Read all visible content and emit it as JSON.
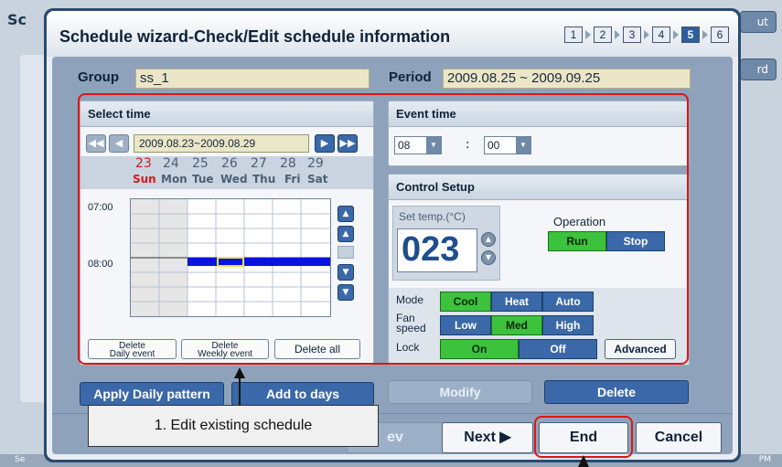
{
  "background": {
    "title_fragment": "Sc",
    "right_btn_1": "ut",
    "right_btn_2": "rd",
    "status_left": "Se",
    "status_right": "PM"
  },
  "dialog": {
    "title": "Schedule wizard-Check/Edit schedule information",
    "steps": [
      "1",
      "2",
      "3",
      "4",
      "5",
      "6"
    ],
    "active_step": "5"
  },
  "group": {
    "label": "Group",
    "value": "ss_1"
  },
  "period": {
    "label": "Period",
    "value": "2009.08.25 ~ 2009.09.25"
  },
  "select_time": {
    "title": "Select time",
    "range": "2009.08.23~2009.08.29",
    "day_numbers": [
      "23",
      "24",
      "25",
      "26",
      "27",
      "28",
      "29"
    ],
    "day_names": [
      "Sun",
      "Mon",
      "Tue",
      "Wed",
      "Thu",
      "Fri",
      "Sat"
    ],
    "time_labels": [
      "07:00",
      "08:00"
    ],
    "buttons": {
      "delete_daily_1": "Delete",
      "delete_daily_2": "Daily event",
      "delete_weekly_1": "Delete",
      "delete_weekly_2": "Weekly event",
      "delete_all": "Delete all"
    }
  },
  "event_time": {
    "title": "Event time",
    "hour": "08",
    "minute": "00",
    "separator": ":"
  },
  "control_setup": {
    "title": "Control Setup",
    "set_temp_label": "Set temp.(°C)",
    "set_temp_value": "023",
    "operation_label": "Operation",
    "operation_options": [
      "Run",
      "Stop"
    ],
    "operation_selected": "Run",
    "mode_label": "Mode",
    "mode_options": [
      "Cool",
      "Heat",
      "Auto"
    ],
    "mode_selected": "Cool",
    "fan_label_1": "Fan",
    "fan_label_2": "speed",
    "fan_options": [
      "Low",
      "Med",
      "High"
    ],
    "fan_selected": "Med",
    "lock_label": "Lock",
    "lock_options": [
      "On",
      "Off"
    ],
    "lock_selected": "On",
    "advanced": "Advanced"
  },
  "actions": {
    "apply_daily": "Apply Daily pattern",
    "add_to_days": "Add to days",
    "modify": "Modify",
    "delete": "Delete",
    "prev": "ev",
    "next": "Next ▶",
    "end": "End",
    "cancel": "Cancel"
  },
  "annotation": {
    "callout": "1. Edit existing schedule"
  },
  "colors": {
    "accent_blue": "#3a68a8",
    "selected_green": "#3cc23c",
    "highlight_red": "#e01414",
    "event_bar": "#0a14e0"
  }
}
